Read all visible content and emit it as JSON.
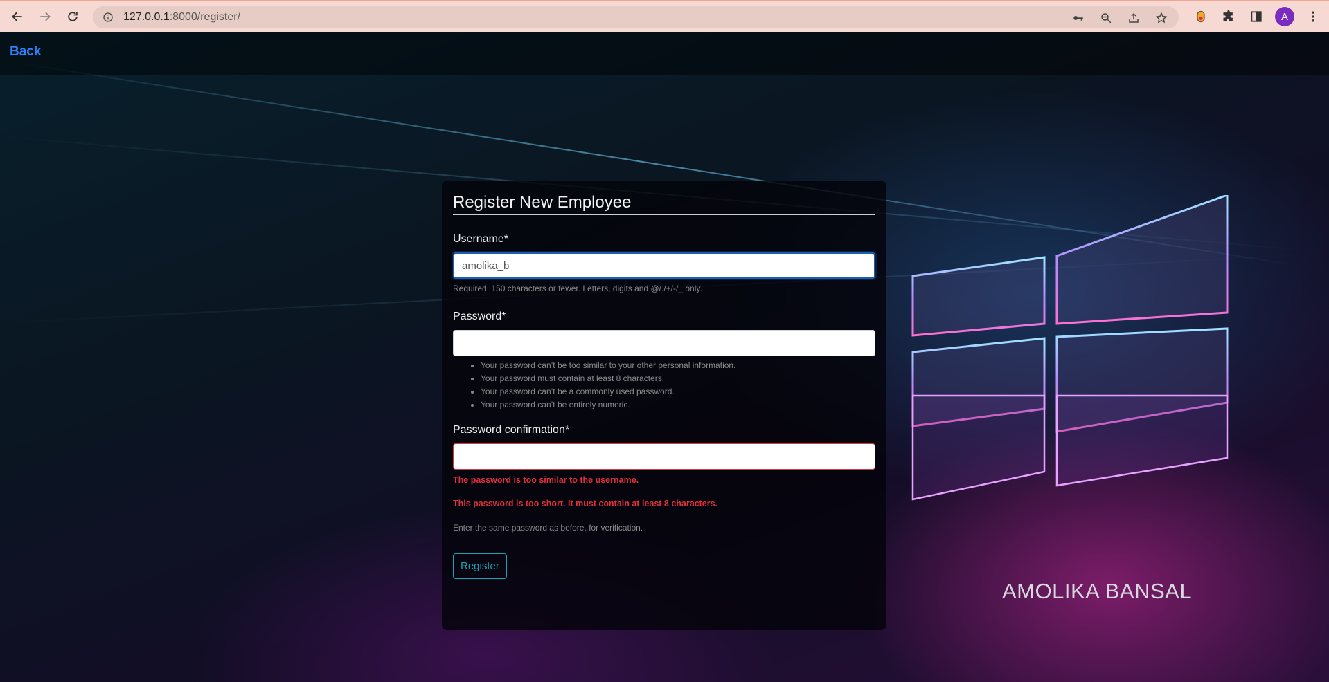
{
  "browser": {
    "url_host": "127.0.0.1",
    "url_path": ":8000/register/",
    "avatar_letter": "A"
  },
  "page": {
    "back_label": "Back",
    "watermark": "AMOLIKA BANSAL"
  },
  "form": {
    "title": "Register New Employee",
    "username": {
      "label": "Username*",
      "value": "amolika_b",
      "help": "Required. 150 characters or fewer. Letters, digits and @/./+/-/_ only."
    },
    "password": {
      "label": "Password*",
      "value": "",
      "help_items": [
        "Your password can’t be too similar to your other personal information.",
        "Your password must contain at least 8 characters.",
        "Your password can’t be a commonly used password.",
        "Your password can’t be entirely numeric."
      ]
    },
    "password_confirmation": {
      "label": "Password confirmation*",
      "value": "",
      "errors": [
        "The password is too similar to the username.",
        "This password is too short. It must contain at least 8 characters."
      ],
      "help": "Enter the same password as before, for verification."
    },
    "submit_label": "Register"
  },
  "colors": {
    "link": "#2f80ff",
    "error": "#e0303e",
    "button_accent": "#17a2b8"
  }
}
